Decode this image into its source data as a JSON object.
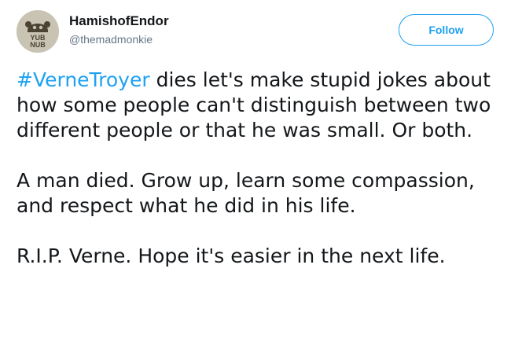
{
  "tweet": {
    "user": {
      "display_name": "HamishofEndor",
      "handle": "@themadmonkie",
      "avatar_text": [
        "YUB",
        "NUB"
      ]
    },
    "follow_label": "Follow",
    "hashtag": "#VerneTroyer",
    "paragraph1_rest": " dies let's make stupid jokes about how some people can't distinguish between two different people or that he was small. Or both.",
    "paragraph2": "A man died. Grow up, learn some compassion, and respect what he did in his life.",
    "paragraph3": "R.I.P. Verne. Hope it's easier in the next life."
  },
  "colors": {
    "accent": "#1da1f2",
    "text": "#14171a",
    "secondary_text": "#657786"
  }
}
